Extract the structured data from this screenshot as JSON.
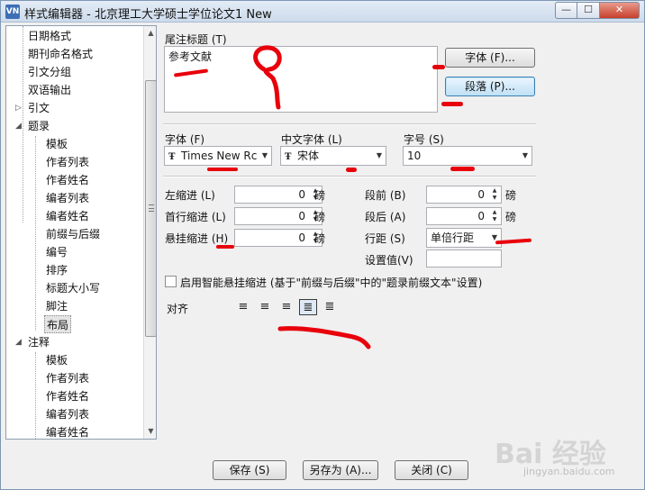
{
  "window": {
    "title": "样式编辑器 - 北京理工大学硕士学位论文1 New",
    "app_icon": "VN",
    "controls": {
      "minimize": "—",
      "maximize": "☐",
      "close": "✕"
    }
  },
  "tree": {
    "items": [
      {
        "label": "日期格式",
        "level": 0
      },
      {
        "label": "期刊命名格式",
        "level": 0
      },
      {
        "label": "引文分组",
        "level": 0
      },
      {
        "label": "双语输出",
        "level": 0
      },
      {
        "label": "引文",
        "level": 0,
        "expander": "collapsed"
      },
      {
        "label": "题录",
        "level": 0,
        "expander": "expanded"
      },
      {
        "label": "模板",
        "level": 1
      },
      {
        "label": "作者列表",
        "level": 1
      },
      {
        "label": "作者姓名",
        "level": 1
      },
      {
        "label": "编者列表",
        "level": 1
      },
      {
        "label": "编者姓名",
        "level": 1
      },
      {
        "label": "前缀与后缀",
        "level": 1
      },
      {
        "label": "编号",
        "level": 1
      },
      {
        "label": "排序",
        "level": 1
      },
      {
        "label": "标题大小写",
        "level": 1
      },
      {
        "label": "脚注",
        "level": 1
      },
      {
        "label": "布局",
        "level": 1,
        "selected": true
      },
      {
        "label": "注释",
        "level": 0,
        "expander": "expanded"
      },
      {
        "label": "模板",
        "level": 1
      },
      {
        "label": "作者列表",
        "level": 1
      },
      {
        "label": "作者姓名",
        "level": 1
      },
      {
        "label": "编者列表",
        "level": 1
      },
      {
        "label": "编者姓名",
        "level": 1
      }
    ]
  },
  "endnote": {
    "title_label": "尾注标题 (T)",
    "title_value": "参考文献",
    "font_button": "字体 (F)...",
    "paragraph_button": "段落 (P)..."
  },
  "fonts": {
    "font_label": "字体 (F)",
    "font_value": "Times New Rc",
    "cn_font_label": "中文字体 (L)",
    "cn_font_value": "宋体",
    "size_label": "字号 (S)",
    "size_value": "10"
  },
  "indent": {
    "left_label": "左缩进 (L)",
    "left_value": "0",
    "first_label": "首行缩进 (L)",
    "first_value": "0",
    "hanging_label": "悬挂缩进 (H)",
    "hanging_value": "0",
    "unit": "磅"
  },
  "spacing": {
    "before_label": "段前 (B)",
    "before_value": "0",
    "after_label": "段后 (A)",
    "after_value": "0",
    "line_label": "行距 (S)",
    "line_value": "单倍行距",
    "setting_label": "设置值(V)",
    "setting_value": "",
    "unit": "磅"
  },
  "smart_hang": {
    "checked": false,
    "label": "启用智能悬挂缩进 (基于\"前缀与后缀\"中的\"题录前缀文本\"设置)"
  },
  "align": {
    "label": "对齐",
    "options": [
      {
        "icon": "align-left-icon",
        "glyph": "≡"
      },
      {
        "icon": "align-center-icon",
        "glyph": "≡"
      },
      {
        "icon": "align-right-icon",
        "glyph": "≡"
      },
      {
        "icon": "align-justify-icon",
        "glyph": "≣",
        "active": true
      },
      {
        "icon": "align-distribute-icon",
        "glyph": "≣"
      }
    ]
  },
  "footer": {
    "save": "保存 (S)",
    "save_as": "另存为 (A)...",
    "close": "关闭 (C)"
  },
  "watermark": {
    "text": "Bai 经验",
    "sub": "jingyan.baidu.com"
  },
  "colors": {
    "annotation": "#e8000b",
    "focus": "#3c7fb1"
  }
}
